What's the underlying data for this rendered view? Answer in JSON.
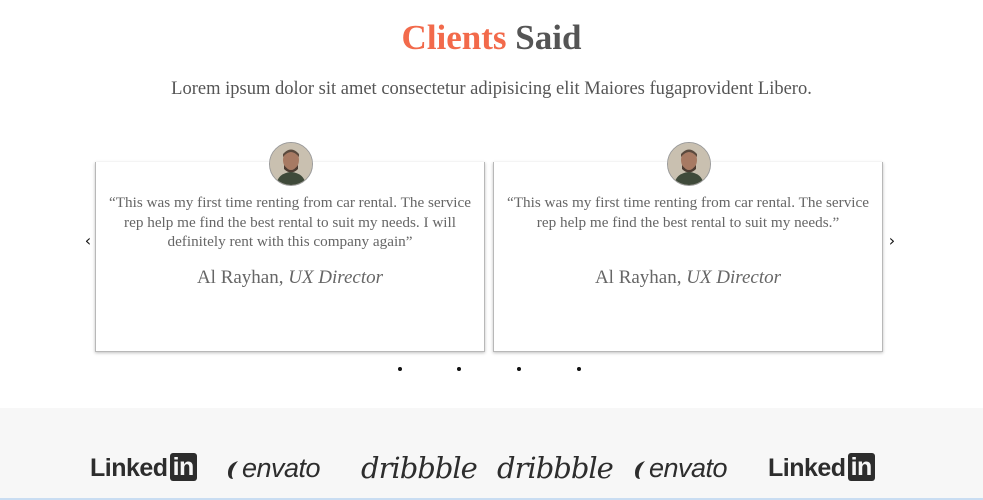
{
  "heading": {
    "accent": "Clients",
    "rest": "Said"
  },
  "subtitle": "Lorem ipsum dolor sit amet consectetur adipisicing elit Maiores fugaprovident Libero.",
  "testimonials": [
    {
      "quote": "“This was my first time renting from car rental. The service rep help me find the best rental to suit my needs. I will definitely rent with this company again”",
      "name": "Al Rayhan,",
      "role": "UX Director"
    },
    {
      "quote": "“This was my first time renting from car rental. The service rep help me find the best rental to suit my needs.”",
      "name": "Al Rayhan,",
      "role": "UX Director"
    }
  ],
  "carousel": {
    "prev_icon": "‹",
    "next_icon": "›",
    "dot_count": 4,
    "active_dot": 0
  },
  "logos": [
    {
      "name": "linkedin",
      "text": "Linked",
      "box": "in"
    },
    {
      "name": "envato",
      "text": "envato"
    },
    {
      "name": "dribbble",
      "text": "dribbble"
    },
    {
      "name": "dribbble",
      "text": "dribbble"
    },
    {
      "name": "envato",
      "text": "envato"
    },
    {
      "name": "linkedin",
      "text": "Linked",
      "box": "in"
    }
  ],
  "colors": {
    "accent": "#f26a4b",
    "text": "#555555",
    "logo": "#2d2d2d"
  }
}
